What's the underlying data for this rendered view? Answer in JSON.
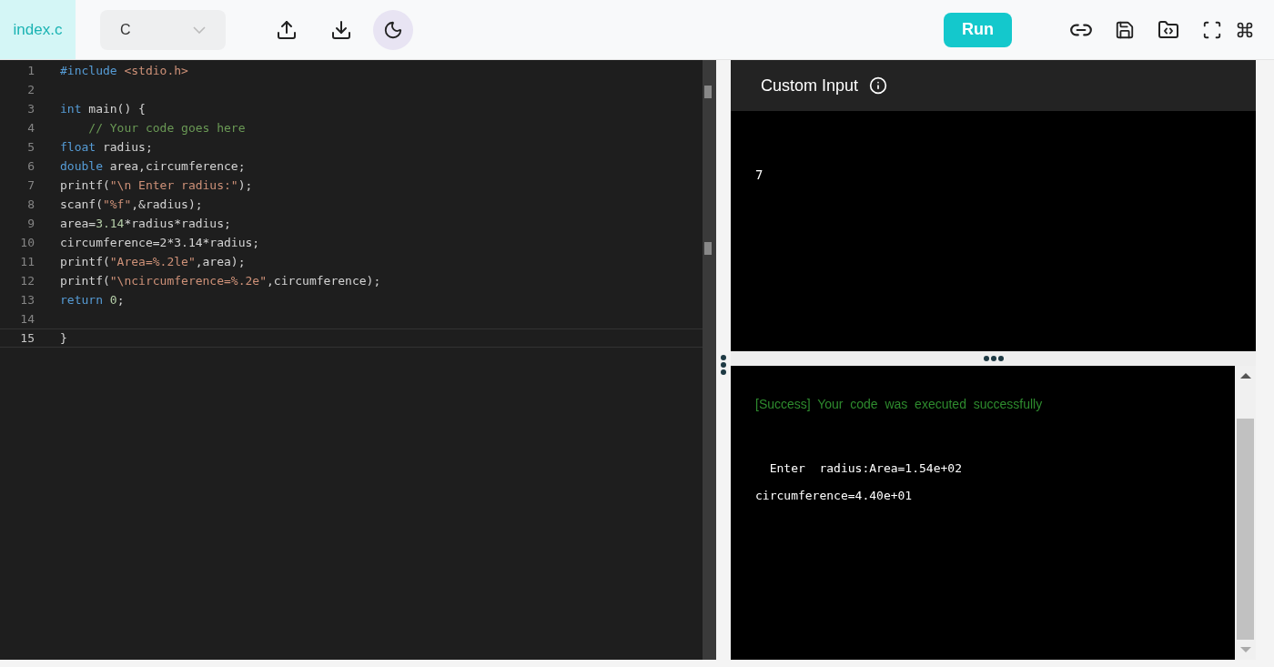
{
  "toolbar": {
    "file_tab": {
      "label": "index.c",
      "selected": true
    },
    "language": {
      "value": "C"
    },
    "run_button": "Run"
  },
  "editor": {
    "lines": [
      {
        "number": "1",
        "current": false,
        "tokens": [
          {
            "text": "#include",
            "kind": "keyword"
          },
          {
            "text": " <stdio.h>",
            "kind": "string"
          }
        ]
      },
      {
        "number": "2",
        "current": false
      },
      {
        "number": "3",
        "current": false,
        "tokens": [
          {
            "text": "int",
            "kind": "keyword"
          },
          {
            "text": " main() {",
            "kind": "plain"
          }
        ]
      },
      {
        "number": "4",
        "current": false,
        "tokens": [
          {
            "text": "    // Your code goes here",
            "kind": "comment"
          }
        ]
      },
      {
        "number": "5",
        "current": false,
        "tokens": [
          {
            "text": "float",
            "kind": "keyword"
          },
          {
            "text": " radius;",
            "kind": "plain"
          }
        ]
      },
      {
        "number": "6",
        "current": false,
        "tokens": [
          {
            "text": "double",
            "kind": "keyword"
          },
          {
            "text": " area,circumference;",
            "kind": "plain"
          }
        ]
      },
      {
        "number": "7",
        "current": false,
        "tokens": [
          {
            "text": "printf(",
            "kind": "plain"
          },
          {
            "text": "\"\\n Enter radius:\"",
            "kind": "string"
          },
          {
            "text": ");",
            "kind": "plain"
          }
        ]
      },
      {
        "number": "8",
        "current": false,
        "tokens": [
          {
            "text": "scanf(",
            "kind": "plain"
          },
          {
            "text": "\"%f\"",
            "kind": "string"
          },
          {
            "text": ",&radius);",
            "kind": "plain"
          }
        ]
      },
      {
        "number": "9",
        "current": false,
        "tokens": [
          {
            "text": "area=",
            "kind": "plain"
          },
          {
            "text": "3.14",
            "kind": "number"
          },
          {
            "text": "*radius*radius;",
            "kind": "plain"
          }
        ]
      },
      {
        "number": "10",
        "current": false,
        "tokens": [
          {
            "text": "circumference=2*3.14*radius;",
            "kind": "plain"
          }
        ]
      },
      {
        "number": "11",
        "current": false,
        "tokens": [
          {
            "text": "printf(",
            "kind": "plain"
          },
          {
            "text": "\"Area=%.2le\"",
            "kind": "string"
          },
          {
            "text": ",area);",
            "kind": "plain"
          }
        ]
      },
      {
        "number": "12",
        "current": false,
        "tokens": [
          {
            "text": "printf(",
            "kind": "plain"
          },
          {
            "text": "\"\\ncircumference=%.2e\"",
            "kind": "string"
          },
          {
            "text": ",circumference);",
            "kind": "plain"
          }
        ]
      },
      {
        "number": "13",
        "current": false,
        "tokens": [
          {
            "text": "return",
            "kind": "keyword"
          },
          {
            "text": " 0",
            "kind": "number"
          },
          {
            "text": ";",
            "kind": "plain"
          }
        ]
      },
      {
        "number": "14",
        "current": false
      },
      {
        "number": "15",
        "current": true,
        "tokens": [
          {
            "text": "}",
            "kind": "plain"
          }
        ]
      }
    ]
  },
  "custom_input": {
    "title": "Custom Input",
    "value": "7"
  },
  "output": {
    "status": "[Success]  Your  code  was  executed  successfully",
    "lines": [
      "  Enter  radius:Area=1.54e+02",
      "circumference=4.40e+01"
    ]
  }
}
